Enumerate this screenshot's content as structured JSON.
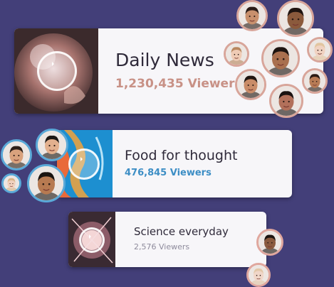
{
  "cards": [
    {
      "title": "Daily News",
      "viewers": "1,230,435 Viewers",
      "accent": "#c89186"
    },
    {
      "title": "Food for thought",
      "viewers": "476,845 Viewers",
      "accent": "#3d8ec5"
    },
    {
      "title": "Science everyday",
      "viewers": "2,576 Viewers",
      "accent": "#8e8b9c"
    }
  ],
  "colors": {
    "background": "#433f79",
    "card": "#f7f6f9"
  },
  "icons": [
    "play-icon",
    "avatar"
  ]
}
